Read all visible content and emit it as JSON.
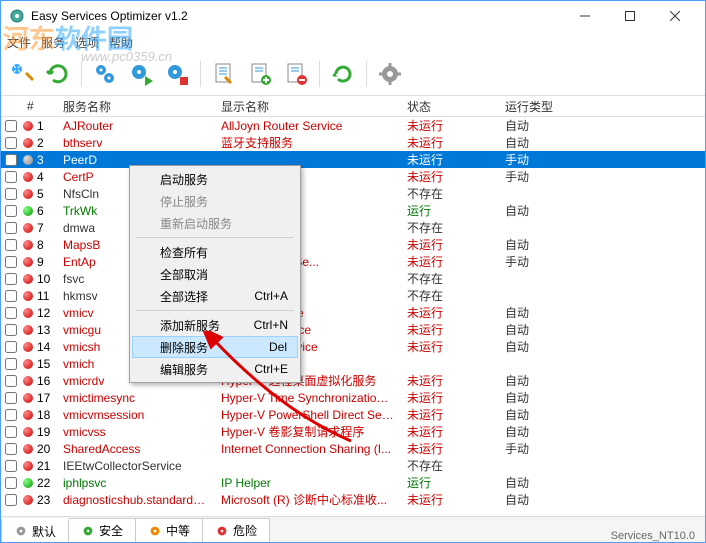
{
  "window": {
    "title": "Easy Services Optimizer v1.2"
  },
  "menubar": [
    "文件",
    "服务",
    "选项",
    "帮助"
  ],
  "watermark": {
    "logo": "河东软件园",
    "url": "www.pc0359.cn"
  },
  "columns": {
    "num": "#",
    "name": "服务名称",
    "disp": "显示名称",
    "stat": "状态",
    "type": "运行类型"
  },
  "rows": [
    {
      "n": "1",
      "dot": "red",
      "name": "AJRouter",
      "disp": "AllJoyn Router Service",
      "stat": "未运行",
      "type": "自动",
      "cls": ""
    },
    {
      "n": "2",
      "dot": "red",
      "name": "bthserv",
      "disp": "蓝牙支持服务",
      "stat": "未运行",
      "type": "自动",
      "cls": ""
    },
    {
      "n": "3",
      "dot": "gray",
      "name": "PeerD",
      "disp": "",
      "stat": "未运行",
      "type": "手动",
      "cls": "sel"
    },
    {
      "n": "4",
      "dot": "red",
      "name": "CertP",
      "disp": "agation",
      "stat": "未运行",
      "type": "手动",
      "cls": ""
    },
    {
      "n": "5",
      "dot": "red",
      "name": "NfsCln",
      "disp": "",
      "stat": "不存在",
      "type": "",
      "cls": "blk nostatus"
    },
    {
      "n": "6",
      "dot": "green",
      "name": "TrkWk",
      "disp": "Tracking Client",
      "stat": "运行",
      "type": "自动",
      "cls": "green-svc running"
    },
    {
      "n": "7",
      "dot": "red",
      "name": "dmwa",
      "disp": "",
      "stat": "不存在",
      "type": "",
      "cls": "blk nostatus"
    },
    {
      "n": "8",
      "dot": "red",
      "name": "MapsB",
      "disp": "ps Manager",
      "stat": "未运行",
      "type": "自动",
      "cls": ""
    },
    {
      "n": "9",
      "dot": "red",
      "name": "EntAp",
      "disp": "Management Se...",
      "stat": "未运行",
      "type": "手动",
      "cls": ""
    },
    {
      "n": "10",
      "dot": "red",
      "name": "fsvc",
      "disp": "",
      "stat": "不存在",
      "type": "",
      "cls": "blk nostatus"
    },
    {
      "n": "11",
      "dot": "red",
      "name": "hkmsv",
      "disp": "",
      "stat": "不存在",
      "type": "",
      "cls": "blk nostatus"
    },
    {
      "n": "12",
      "dot": "red",
      "name": "vmicv",
      "disp": "change Service",
      "stat": "未运行",
      "type": "自动",
      "cls": ""
    },
    {
      "n": "13",
      "dot": "red",
      "name": "vmicgu",
      "disp": "Service Interface",
      "stat": "未运行",
      "type": "自动",
      "cls": ""
    },
    {
      "n": "14",
      "dot": "red",
      "name": "vmicsh",
      "disp": "Shutdown Service",
      "stat": "未运行",
      "type": "自动",
      "cls": ""
    },
    {
      "n": "15",
      "dot": "red",
      "name": "vmich",
      "disp": "",
      "stat": "",
      "type": "",
      "cls": ""
    },
    {
      "n": "16",
      "dot": "red",
      "name": "vmicrdv",
      "disp": "Hyper-V 远程桌面虚拟化服务",
      "stat": "未运行",
      "type": "自动",
      "cls": ""
    },
    {
      "n": "17",
      "dot": "red",
      "name": "vmictimesync",
      "disp": "Hyper-V Time Synchronization ...",
      "stat": "未运行",
      "type": "自动",
      "cls": ""
    },
    {
      "n": "18",
      "dot": "red",
      "name": "vmicvmsession",
      "disp": "Hyper-V PowerShell Direct Ser...",
      "stat": "未运行",
      "type": "自动",
      "cls": ""
    },
    {
      "n": "19",
      "dot": "red",
      "name": "vmicvss",
      "disp": "Hyper-V 卷影复制请求程序",
      "stat": "未运行",
      "type": "自动",
      "cls": ""
    },
    {
      "n": "20",
      "dot": "red",
      "name": "SharedAccess",
      "disp": "Internet Connection Sharing (I...",
      "stat": "未运行",
      "type": "手动",
      "cls": ""
    },
    {
      "n": "21",
      "dot": "red",
      "name": "IEEtwCollectorService",
      "disp": "",
      "stat": "不存在",
      "type": "",
      "cls": "blk nostatus"
    },
    {
      "n": "22",
      "dot": "green",
      "name": "iphlpsvc",
      "disp": "IP Helper",
      "stat": "运行",
      "type": "自动",
      "cls": "green-svc running"
    },
    {
      "n": "23",
      "dot": "red",
      "name": "diagnosticshub.standardc...",
      "disp": "Microsoft (R) 诊断中心标准收...",
      "stat": "未运行",
      "type": "自动",
      "cls": ""
    }
  ],
  "context_menu": {
    "start": "启动服务",
    "stop": "停止服务",
    "restart": "重新启动服务",
    "check_all": "检查所有",
    "uncheck_all": "全部取消",
    "select_all": "全部选择",
    "add": "添加新服务",
    "delete": "删除服务",
    "edit": "编辑服务",
    "sc_selall": "Ctrl+A",
    "sc_add": "Ctrl+N",
    "sc_del": "Del",
    "sc_edit": "Ctrl+E"
  },
  "tabs": {
    "default": "默认",
    "safe": "安全",
    "medium": "中等",
    "danger": "危险"
  },
  "statusbar": {
    "right": "Services_NT10.0"
  }
}
